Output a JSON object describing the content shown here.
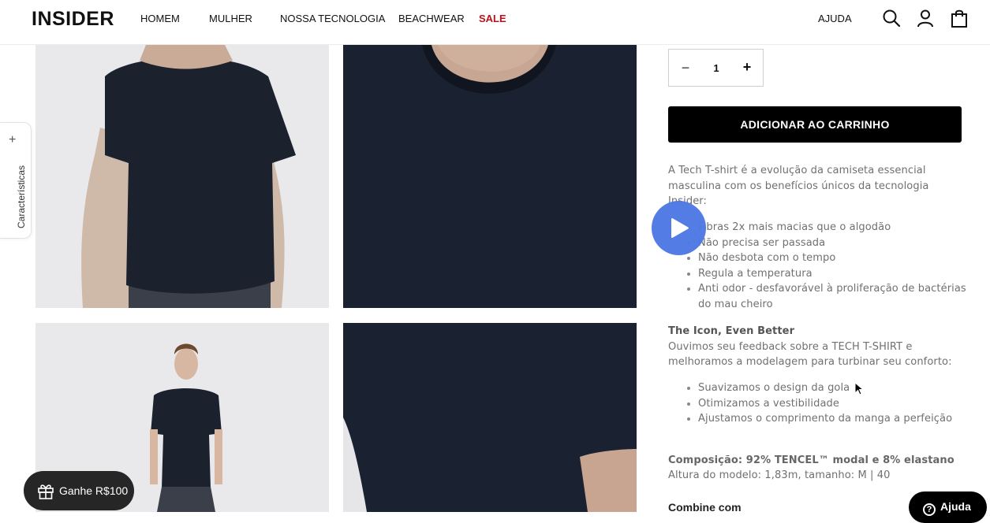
{
  "header": {
    "logo": "INSIDER",
    "nav": [
      "HOMEM",
      "MULHER",
      "NOSSA TECNOLOGIA",
      "BEACHWEAR",
      "SALE"
    ],
    "help": "AJUDA",
    "icons": [
      "search-icon",
      "user-icon",
      "bag-icon"
    ],
    "sale_color": "#b5121b"
  },
  "side_tab": {
    "plus": "+",
    "label": "Características"
  },
  "gallery": {
    "images": [
      "tshirt-back-view",
      "tshirt-collar-closeup",
      "model-full-body",
      "tshirt-sleeve-closeup"
    ]
  },
  "purchase": {
    "qty_minus": "−",
    "quantity": "1",
    "qty_plus": "+",
    "add_to_cart": "ADICIONAR AO CARRINHO"
  },
  "description": {
    "intro": "A Tech T-shirt é a evolução da camiseta essencial masculina com os benefícios únicos da tecnologia Insider:",
    "benefits": [
      "Fibras 2x mais macias que o algodão",
      "Não precisa ser passada",
      "Não desbota com o tempo",
      "Regula a temperatura",
      "Anti odor - desfavorável à proliferação de bactérias do mau cheiro"
    ],
    "icon_title": "The Icon, Even Better",
    "icon_text": "Ouvimos seu feedback sobre a TECH T-SHIRT e melhoramos a modelagem para turbinar seu conforto:",
    "improvements": [
      "Suavizamos o design da gola",
      "Otimizamos a vestibilidade",
      "Ajustamos o comprimento da manga a perfeição"
    ],
    "composition": "Composição: 92% TENCEL™ modal e 8% elastano",
    "model": "Altura do modelo: 1,83m, tamanho: M | 40",
    "combine": "Combine com"
  },
  "floating": {
    "gift": "Ganhe R$100",
    "help": "Ajuda",
    "play_color": "#4e79e4"
  }
}
